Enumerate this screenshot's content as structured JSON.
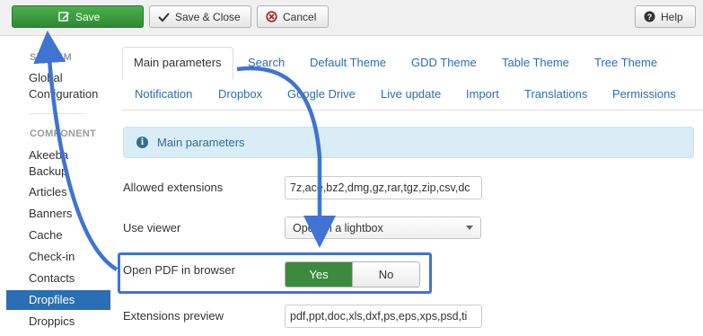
{
  "toolbar": {
    "save_label": "Save",
    "save_close_label": "Save & Close",
    "cancel_label": "Cancel",
    "help_label": "Help"
  },
  "sidebar": {
    "system_heading": "SYSTEM",
    "global_line1": "Global",
    "global_line2": "Configuration",
    "component_heading": "COMPONENT",
    "akeeba_line1": "Akeeba",
    "akeeba_line2": "Backup",
    "items": [
      "Articles",
      "Banners",
      "Cache",
      "Check-in",
      "Contacts",
      "Dropfiles",
      "Droppics"
    ],
    "active_item": "Dropfiles"
  },
  "tabs": {
    "row1": [
      "Main parameters",
      "Search",
      "Default Theme",
      "GDD Theme",
      "Table Theme",
      "Tree Theme"
    ],
    "row2": [
      "Notification",
      "Dropbox",
      "Google Drive",
      "Live update",
      "Import",
      "Translations",
      "Permissions"
    ],
    "active": "Main parameters"
  },
  "alert": {
    "text": "Main parameters",
    "icon": "info-icon"
  },
  "form": {
    "allowed_extensions_label": "Allowed extensions",
    "allowed_extensions_value": "7z,ace,bz2,dmg,gz,rar,tgz,zip,csv,dc",
    "use_viewer_label": "Use viewer",
    "use_viewer_value": "Open in a lightbox",
    "open_pdf_label": "Open PDF in browser",
    "open_pdf_yes": "Yes",
    "open_pdf_no": "No",
    "open_pdf_selected": "Yes",
    "extensions_preview_label": "Extensions preview",
    "extensions_preview_value": "pdf,ppt,doc,xls,dxf,ps,eps,xps,psd,ti"
  },
  "colors": {
    "save_green": "#3c8a3e",
    "active_blue": "#2a6eb4",
    "annotation_blue": "#3f73d4",
    "alert_bg": "#d9edf7"
  }
}
